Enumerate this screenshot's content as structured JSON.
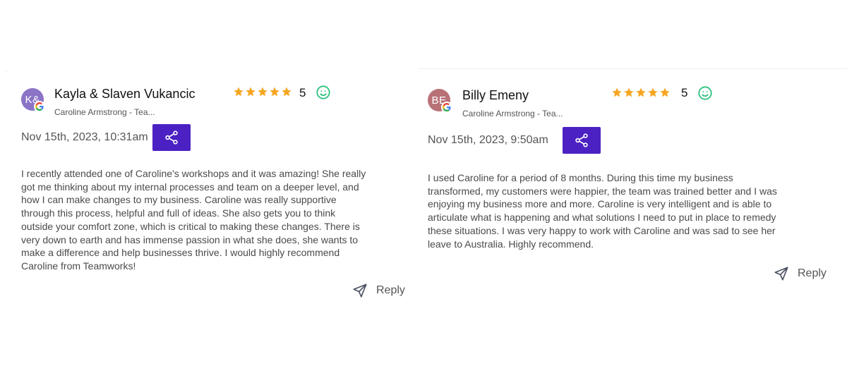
{
  "colors": {
    "share_button": "#4c21c3",
    "star": "#f5a623",
    "smile": "#2ec27e",
    "google_blue": "#4285F4",
    "google_red": "#EA4335",
    "google_yellow": "#FBBC05",
    "google_green": "#34A853"
  },
  "reviews": [
    {
      "avatar_initials": "K&",
      "avatar_color": "#8b74c6",
      "name": "Kayla & Slaven Vukancic",
      "subtitle": "Caroline Armstrong - Tea...",
      "rating": "5",
      "stars": 5,
      "date": "Nov 15th, 2023, 10:31am",
      "text": "I recently attended one of Caroline's workshops and it was amazing! She really got me thinking about my internal processes and team on a deeper level, and how I can make changes to my business. Caroline was really supportive through this process, helpful and full of ideas. She also gets you to think outside your comfort zone, which is critical to making these changes. There is very down to earth and has immense passion in what she does, she wants to make a difference and help businesses thrive. I would highly recommend Caroline from Teamworks!",
      "reply_label": "Reply",
      "source_icon": "google-icon",
      "sentiment_icon": "smile-icon",
      "share_icon": "share-icon",
      "reply_icon": "send-icon"
    },
    {
      "avatar_initials": "BE",
      "avatar_color": "#b87277",
      "name": "Billy Emeny",
      "subtitle": "Caroline Armstrong - Tea...",
      "rating": "5",
      "stars": 5,
      "date": "Nov 15th, 2023, 9:50am",
      "text": "I used Caroline for a period of 8 months. During this time my business transformed, my customers were happier, the team was trained better and I was enjoying my business more and more. Caroline is very intelligent and is able to articulate what is happening and what solutions I need to put in place to remedy these situations. I was very happy to work with Caroline and was sad to see her leave to Australia. Highly recommend.",
      "reply_label": "Reply",
      "source_icon": "google-icon",
      "sentiment_icon": "smile-icon",
      "share_icon": "share-icon",
      "reply_icon": "send-icon"
    }
  ]
}
